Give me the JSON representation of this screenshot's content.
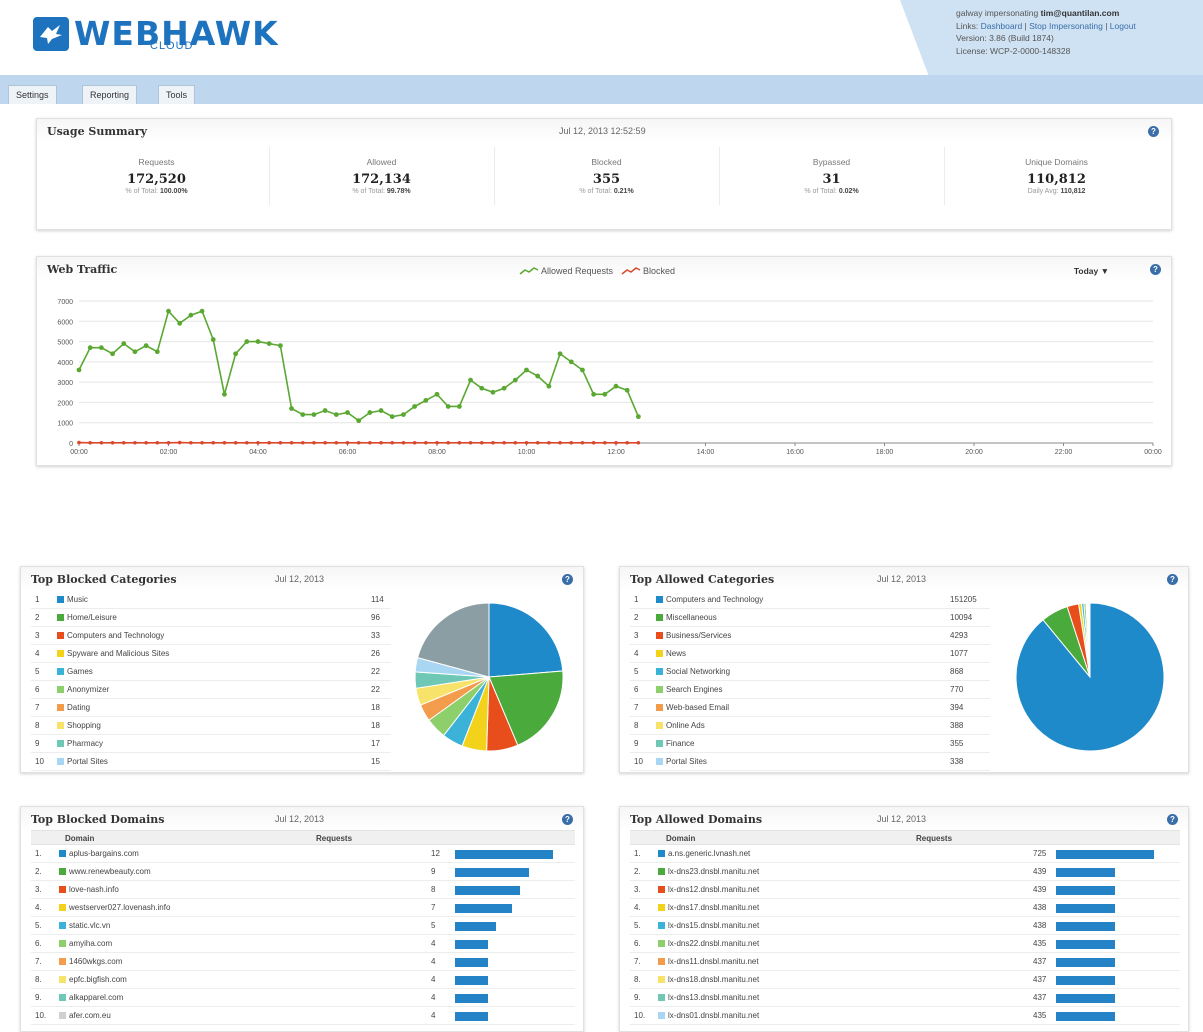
{
  "brand": {
    "name": "WEBHAWK",
    "sub": "CLOUD",
    "color": "#1e73be"
  },
  "account": {
    "impersonating_label": "galway impersonating",
    "email": "tim@quantilan.com",
    "links_label": "Links:",
    "links": [
      "Dashboard",
      "Stop Impersonating",
      "Logout"
    ],
    "version": "Version: 3.86 (Build 1874)",
    "license": "License: WCP-2-0000-148328"
  },
  "tabs": [
    "Settings",
    "Reporting",
    "Tools"
  ],
  "usage": {
    "title": "Usage Summary",
    "date": "Jul 12, 2013 12:52:59",
    "stats": [
      {
        "label": "Requests",
        "value": "172,520",
        "sub_label": "% of Total:",
        "sub_value": "100.00%"
      },
      {
        "label": "Allowed",
        "value": "172,134",
        "sub_label": "% of Total:",
        "sub_value": "99.78%"
      },
      {
        "label": "Blocked",
        "value": "355",
        "sub_label": "% of Total:",
        "sub_value": "0.21%"
      },
      {
        "label": "Bypassed",
        "value": "31",
        "sub_label": "% of Total:",
        "sub_value": "0.02%"
      },
      {
        "label": "Unique Domains",
        "value": "110,812",
        "sub_label": "Daily Avg:",
        "sub_value": "110,812"
      }
    ]
  },
  "traffic": {
    "title": "Web Traffic",
    "legend_allowed": "Allowed Requests",
    "legend_blocked": "Blocked",
    "range": "Today ▼"
  },
  "chart_data": {
    "type": "line",
    "ylim": [
      0,
      7000
    ],
    "yticks": [
      "7000",
      "6000",
      "5000",
      "4000",
      "3000",
      "2000",
      "1000",
      "0"
    ],
    "xticks": [
      "00:00",
      "02:00",
      "04:00",
      "06:00",
      "08:00",
      "10:00",
      "12:00",
      "14:00",
      "16:00",
      "18:00",
      "20:00",
      "22:00",
      "00:00"
    ],
    "series": [
      {
        "name": "Allowed Requests",
        "color": "#5aa832",
        "values": [
          3600,
          4700,
          4700,
          4400,
          4900,
          4500,
          4800,
          4500,
          6500,
          5900,
          6300,
          6500,
          5100,
          2400,
          4400,
          5000,
          5000,
          4900,
          4800,
          1700,
          1400,
          1400,
          1600,
          1400,
          1500,
          1100,
          1500,
          1600,
          1300,
          1400,
          1800,
          2100,
          2400,
          1800,
          1800,
          3100,
          2700,
          2500,
          2700,
          3100,
          3600,
          3300,
          2800,
          4400,
          4000,
          3600,
          2400,
          2400,
          2800,
          2600,
          1300
        ]
      },
      {
        "name": "Blocked",
        "color": "#d9482c",
        "values": [
          20,
          10,
          10,
          10,
          10,
          10,
          10,
          10,
          10,
          20,
          10,
          10,
          10,
          10,
          10,
          10,
          10,
          10,
          10,
          10,
          10,
          10,
          10,
          10,
          10,
          10,
          10,
          10,
          10,
          10,
          10,
          10,
          10,
          10,
          10,
          10,
          10,
          10,
          10,
          10,
          10,
          10,
          10,
          10,
          10,
          10,
          10,
          10,
          10,
          10,
          10
        ]
      }
    ]
  },
  "blocked_categories": {
    "title": "Top Blocked Categories",
    "date": "Jul 12, 2013",
    "rows": [
      {
        "rank": "1",
        "name": "Music",
        "count": "114",
        "color": "#1f8ac9"
      },
      {
        "rank": "2",
        "name": "Home/Leisure",
        "count": "96",
        "color": "#4aaa3b"
      },
      {
        "rank": "3",
        "name": "Computers and Technology",
        "count": "33",
        "color": "#e84e1c"
      },
      {
        "rank": "4",
        "name": "Spyware and Malicious Sites",
        "count": "26",
        "color": "#f3d21c"
      },
      {
        "rank": "5",
        "name": "Games",
        "count": "22",
        "color": "#3bb3d9"
      },
      {
        "rank": "6",
        "name": "Anonymizer",
        "count": "22",
        "color": "#8ccf6b"
      },
      {
        "rank": "7",
        "name": "Dating",
        "count": "18",
        "color": "#f39c4b"
      },
      {
        "rank": "8",
        "name": "Shopping",
        "count": "18",
        "color": "#f8e36a"
      },
      {
        "rank": "9",
        "name": "Pharmacy",
        "count": "17",
        "color": "#6fc7b5"
      },
      {
        "rank": "10",
        "name": "Portal Sites",
        "count": "15",
        "color": "#a9d6f2"
      }
    ],
    "pie": [
      114,
      96,
      33,
      26,
      22,
      22,
      18,
      18,
      17,
      15,
      100
    ],
    "other_color": "#8a9ea3"
  },
  "allowed_categories": {
    "title": "Top Allowed Categories",
    "date": "Jul 12, 2013",
    "rows": [
      {
        "rank": "1",
        "name": "Computers and Technology",
        "count": "151205",
        "color": "#1f8ac9"
      },
      {
        "rank": "2",
        "name": "Miscellaneous",
        "count": "10094",
        "color": "#4aaa3b"
      },
      {
        "rank": "3",
        "name": "Business/Services",
        "count": "4293",
        "color": "#e84e1c"
      },
      {
        "rank": "4",
        "name": "News",
        "count": "1077",
        "color": "#f3d21c"
      },
      {
        "rank": "5",
        "name": "Social Networking",
        "count": "868",
        "color": "#3bb3d9"
      },
      {
        "rank": "6",
        "name": "Search Engines",
        "count": "770",
        "color": "#8ccf6b"
      },
      {
        "rank": "7",
        "name": "Web-based Email",
        "count": "394",
        "color": "#f39c4b"
      },
      {
        "rank": "8",
        "name": "Online Ads",
        "count": "388",
        "color": "#f8e36a"
      },
      {
        "rank": "9",
        "name": "Finance",
        "count": "355",
        "color": "#6fc7b5"
      },
      {
        "rank": "10",
        "name": "Portal Sites",
        "count": "338",
        "color": "#a9d6f2"
      }
    ],
    "pie": [
      151205,
      10094,
      4293,
      1077,
      868,
      770,
      394,
      388,
      355,
      338
    ],
    "other_color": "#8a9ea3"
  },
  "blocked_domains": {
    "title": "Top Blocked Domains",
    "date": "Jul 12, 2013",
    "col_domain": "Domain",
    "col_requests": "Requests",
    "rows": [
      {
        "rank": "1.",
        "name": "aplus-bargains.com",
        "count": "12",
        "color": "#1f8ac9"
      },
      {
        "rank": "2.",
        "name": "www.renewbeauty.com",
        "count": "9",
        "color": "#4aaa3b"
      },
      {
        "rank": "3.",
        "name": "love-nash.info",
        "count": "8",
        "color": "#e84e1c"
      },
      {
        "rank": "4.",
        "name": "westserver027.lovenash.info",
        "count": "7",
        "color": "#f3d21c"
      },
      {
        "rank": "5.",
        "name": "static.vlc.vn",
        "count": "5",
        "color": "#3bb3d9"
      },
      {
        "rank": "6.",
        "name": "amyiha.com",
        "count": "4",
        "color": "#8ccf6b"
      },
      {
        "rank": "7.",
        "name": "1460wkgs.com",
        "count": "4",
        "color": "#f39c4b"
      },
      {
        "rank": "8.",
        "name": "epfc.bigfish.com",
        "count": "4",
        "color": "#f8e36a"
      },
      {
        "rank": "9.",
        "name": "alkapparel.com",
        "count": "4",
        "color": "#6fc7b5"
      },
      {
        "rank": "10.",
        "name": "afer.com.eu",
        "count": "4",
        "color": "#d0d0d0"
      }
    ],
    "max": 12
  },
  "allowed_domains": {
    "title": "Top Allowed Domains",
    "date": "Jul 12, 2013",
    "col_domain": "Domain",
    "col_requests": "Requests",
    "rows": [
      {
        "rank": "1.",
        "name": "a.ns.generic.lvnash.net",
        "count": "725",
        "color": "#1f8ac9"
      },
      {
        "rank": "2.",
        "name": "lx-dns23.dnsbl.manitu.net",
        "count": "439",
        "color": "#4aaa3b"
      },
      {
        "rank": "3.",
        "name": "lx-dns12.dnsbl.manitu.net",
        "count": "439",
        "color": "#e84e1c"
      },
      {
        "rank": "4.",
        "name": "lx-dns17.dnsbl.manitu.net",
        "count": "438",
        "color": "#f3d21c"
      },
      {
        "rank": "5.",
        "name": "lx-dns15.dnsbl.manitu.net",
        "count": "438",
        "color": "#3bb3d9"
      },
      {
        "rank": "6.",
        "name": "lx-dns22.dnsbl.manitu.net",
        "count": "435",
        "color": "#8ccf6b"
      },
      {
        "rank": "7.",
        "name": "lx-dns11.dnsbl.manitu.net",
        "count": "437",
        "color": "#f39c4b"
      },
      {
        "rank": "8.",
        "name": "lx-dns18.dnsbl.manitu.net",
        "count": "437",
        "color": "#f8e36a"
      },
      {
        "rank": "9.",
        "name": "lx-dns13.dnsbl.manitu.net",
        "count": "437",
        "color": "#6fc7b5"
      },
      {
        "rank": "10.",
        "name": "lx-dns01.dnsbl.manitu.net",
        "count": "435",
        "color": "#a9d6f2"
      }
    ],
    "max": 725
  }
}
